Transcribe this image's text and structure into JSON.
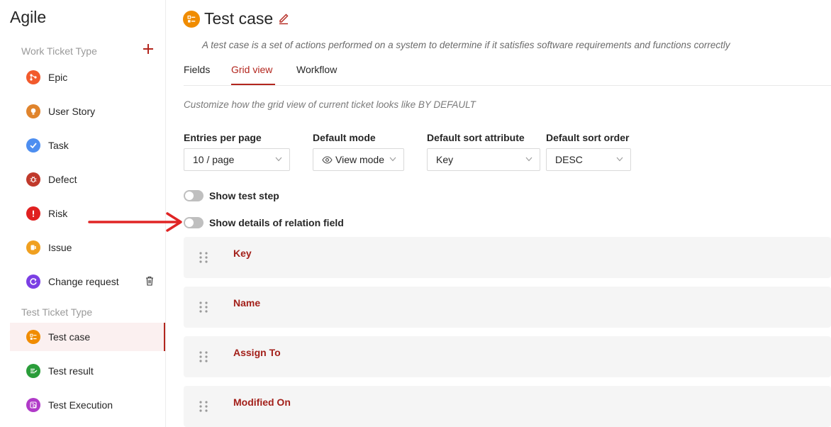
{
  "app": {
    "title": "Agile"
  },
  "sidebar": {
    "work_section_label": "Work Ticket Type",
    "test_section_label": "Test Ticket Type",
    "work_items": [
      {
        "label": "Epic",
        "icon": "epic-icon",
        "color": "#f25a2c"
      },
      {
        "label": "User Story",
        "icon": "user-story-icon",
        "color": "#e0842c"
      },
      {
        "label": "Task",
        "icon": "task-icon",
        "color": "#4d8ef0"
      },
      {
        "label": "Defect",
        "icon": "defect-icon",
        "color": "#c0392b"
      },
      {
        "label": "Risk",
        "icon": "risk-icon",
        "color": "#e02020"
      },
      {
        "label": "Issue",
        "icon": "issue-icon",
        "color": "#f0a020"
      },
      {
        "label": "Change request",
        "icon": "change-request-icon",
        "color": "#7b3fe4"
      }
    ],
    "test_items": [
      {
        "label": "Test case",
        "icon": "test-case-icon",
        "color": "#f08c00",
        "active": true
      },
      {
        "label": "Test result",
        "icon": "test-result-icon",
        "color": "#2a9d3a"
      },
      {
        "label": "Test Execution",
        "icon": "test-execution-icon",
        "color": "#b03ac8"
      }
    ]
  },
  "header": {
    "title": "Test case",
    "description": "A test case is a set of actions performed on a system to determine if it satisfies software requirements and functions correctly"
  },
  "tabs": [
    {
      "label": "Fields"
    },
    {
      "label": "Grid view",
      "active": true
    },
    {
      "label": "Workflow"
    }
  ],
  "grid": {
    "subtitle": "Customize how the grid view of current ticket looks like BY DEFAULT",
    "entries_label": "Entries per page",
    "entries_value": "10 / page",
    "mode_label": "Default mode",
    "mode_value": "View mode",
    "sort_attr_label": "Default sort attribute",
    "sort_attr_value": "Key",
    "sort_order_label": "Default sort order",
    "sort_order_value": "DESC",
    "toggle_test_step": "Show test step",
    "toggle_relation": "Show details of relation field",
    "columns": [
      "Key",
      "Name",
      "Assign To",
      "Modified On"
    ]
  },
  "colors": {
    "accent": "#b3261e",
    "annotation_arrow": "#e02424"
  }
}
